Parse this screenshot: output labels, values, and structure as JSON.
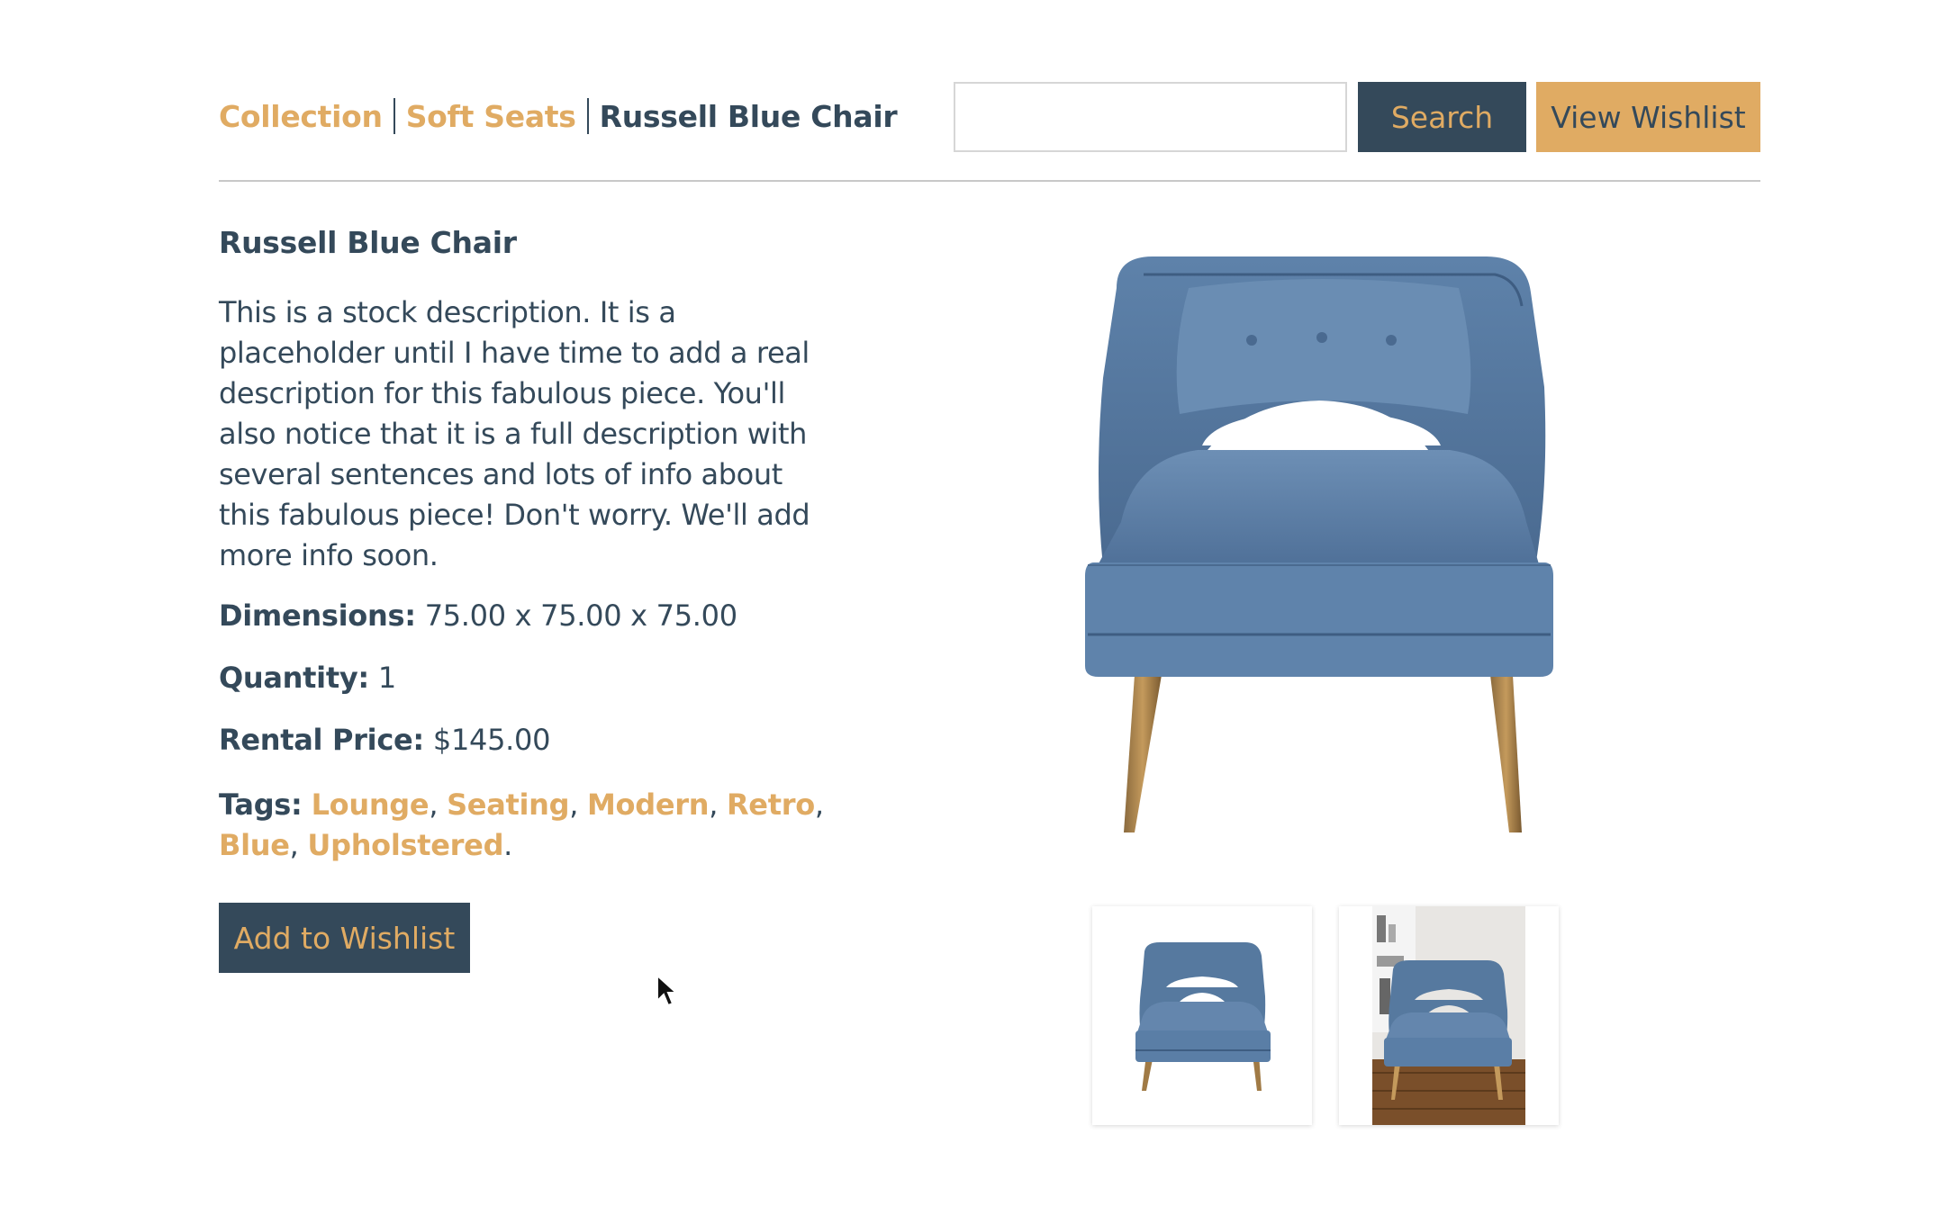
{
  "breadcrumb": {
    "items": [
      {
        "label": "Collection"
      },
      {
        "label": "Soft Seats"
      },
      {
        "label": "Russell Blue Chair"
      }
    ]
  },
  "search": {
    "value": "",
    "placeholder": "",
    "button_label": "Search"
  },
  "header": {
    "view_wishlist_label": "View Wishlist"
  },
  "product": {
    "title": "Russell Blue Chair",
    "description": "This is a stock description. It is a placeholder until I have time to add a real description for this fabulous piece. You'll also notice that it is a full description with several sentences and lots of info about this fabulous piece! Don't worry. We'll add more info soon.",
    "dimensions_label": "Dimensions:",
    "dimensions_value": "75.00 x 75.00 x 75.00",
    "quantity_label": "Quantity:",
    "quantity_value": "1",
    "price_label": "Rental Price:",
    "price_value": "$145.00",
    "tags_label": "Tags:",
    "tags": [
      "Lounge",
      "Seating",
      "Modern",
      "Retro",
      "Blue",
      "Upholstered"
    ],
    "add_to_wishlist_label": "Add to Wishlist"
  },
  "colors": {
    "navy": "#34495a",
    "gold": "#e0ab63",
    "chair_blue": "#5b7ea4"
  },
  "icons": [
    "armchair-image",
    "armchair-thumbnail",
    "room-armchair-thumbnail",
    "mouse-pointer-icon"
  ]
}
